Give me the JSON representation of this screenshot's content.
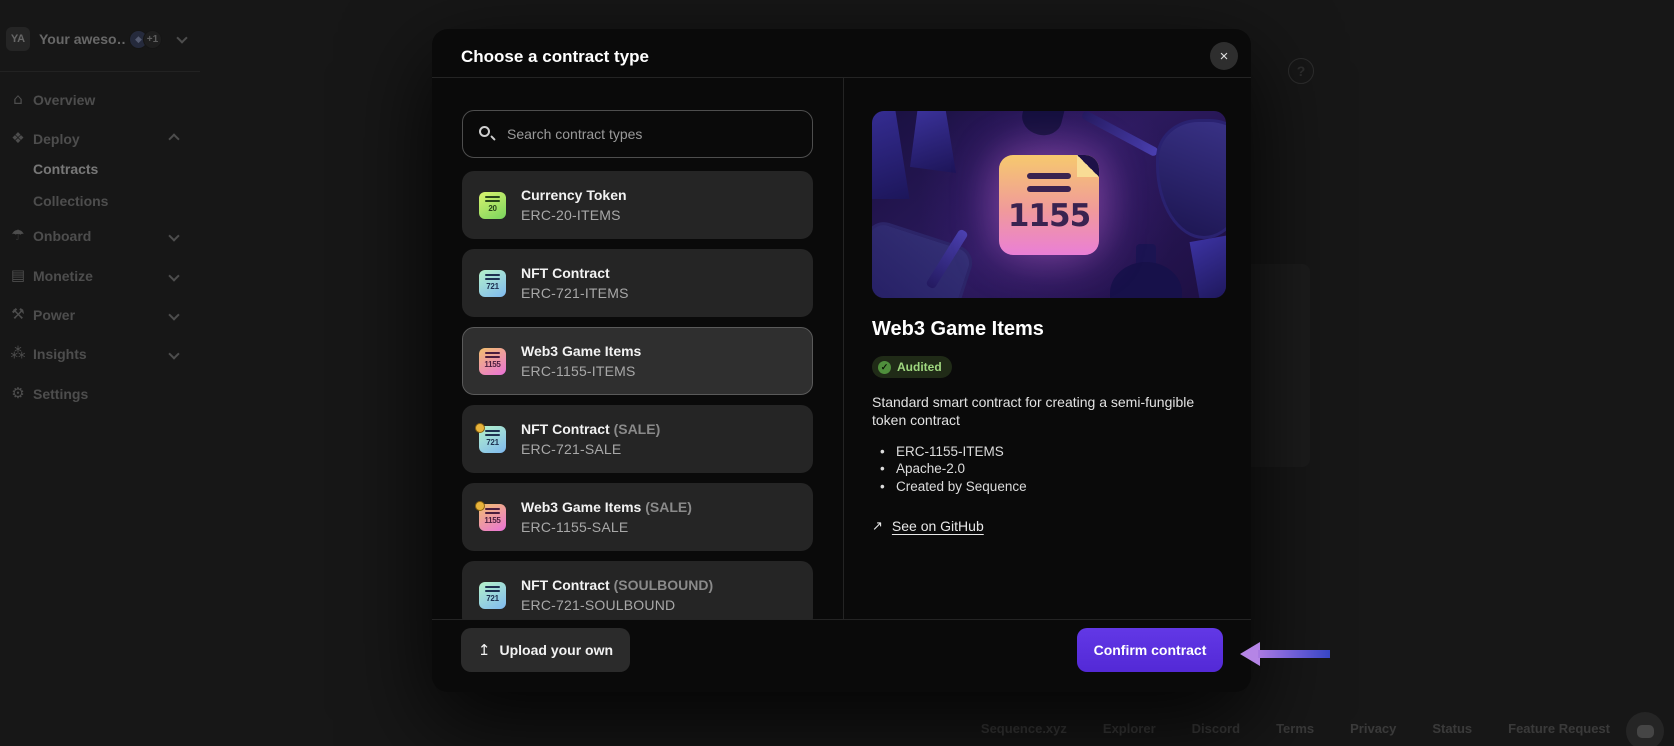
{
  "workspace": {
    "avatar_initials": "YA",
    "name": "Your aweso…",
    "extra_members": "+1"
  },
  "sidebar": {
    "items": [
      {
        "label": "Overview",
        "icon": "home",
        "glyph": "⌂"
      },
      {
        "label": "Deploy",
        "icon": "deploy",
        "glyph": "❖",
        "expanded": true
      },
      {
        "label": "Contracts",
        "child": true,
        "active": true
      },
      {
        "label": "Collections",
        "child": true
      },
      {
        "label": "Onboard",
        "icon": "parachute",
        "glyph": "☂"
      },
      {
        "label": "Monetize",
        "icon": "coins",
        "glyph": "▤"
      },
      {
        "label": "Power",
        "icon": "anvil",
        "glyph": "⚒"
      },
      {
        "label": "Insights",
        "icon": "users",
        "glyph": "⁂"
      },
      {
        "label": "Settings",
        "icon": "gear",
        "glyph": "⚙"
      }
    ]
  },
  "modal": {
    "title": "Choose a contract type",
    "search_placeholder": "Search contract types",
    "contracts": [
      {
        "name": "Currency Token",
        "variant": "",
        "code": "ERC-20-ITEMS",
        "icon_number": "20",
        "selected": false
      },
      {
        "name": "NFT Contract",
        "variant": "",
        "code": "ERC-721-ITEMS",
        "icon_number": "721",
        "selected": false
      },
      {
        "name": "Web3 Game Items",
        "variant": "",
        "code": "ERC-1155-ITEMS",
        "icon_number": "1155",
        "selected": true
      },
      {
        "name": "NFT Contract",
        "variant": "(SALE)",
        "code": "ERC-721-SALE",
        "icon_number": "721",
        "selected": false
      },
      {
        "name": "Web3 Game Items",
        "variant": "(SALE)",
        "code": "ERC-1155-SALE",
        "icon_number": "1155",
        "selected": false
      },
      {
        "name": "NFT Contract",
        "variant": "(SOULBOUND)",
        "code": "ERC-721-SOULBOUND",
        "icon_number": "721",
        "selected": false
      }
    ],
    "details": {
      "hero_number": "1155",
      "title": "Web3 Game Items",
      "badge": "Audited",
      "description": "Standard smart contract for creating a semi-fungible token contract",
      "bullets": [
        "ERC-1155-ITEMS",
        "Apache-2.0",
        "Created by Sequence"
      ],
      "github_link": "See on GitHub"
    },
    "upload_button": "Upload your own",
    "confirm_button": "Confirm contract"
  },
  "footer": {
    "links": [
      "Sequence.xyz",
      "Explorer",
      "Discord",
      "Terms",
      "Privacy",
      "Status",
      "Feature Request"
    ]
  },
  "icons": {
    "close": "×",
    "upload": "↥",
    "external_link": "↗",
    "check": "✓",
    "eth": "◆",
    "help": "?"
  },
  "colors": {
    "accent_purple": "#5b30dc",
    "audited_green": "#9fd77f",
    "erc20_icon": "#79d45e",
    "erc721_icon": "#7fb9f0",
    "erc1155_icon": "#ea72d9",
    "arrow_gradient_start": "#b585e6",
    "arrow_gradient_end": "#3746c4"
  }
}
